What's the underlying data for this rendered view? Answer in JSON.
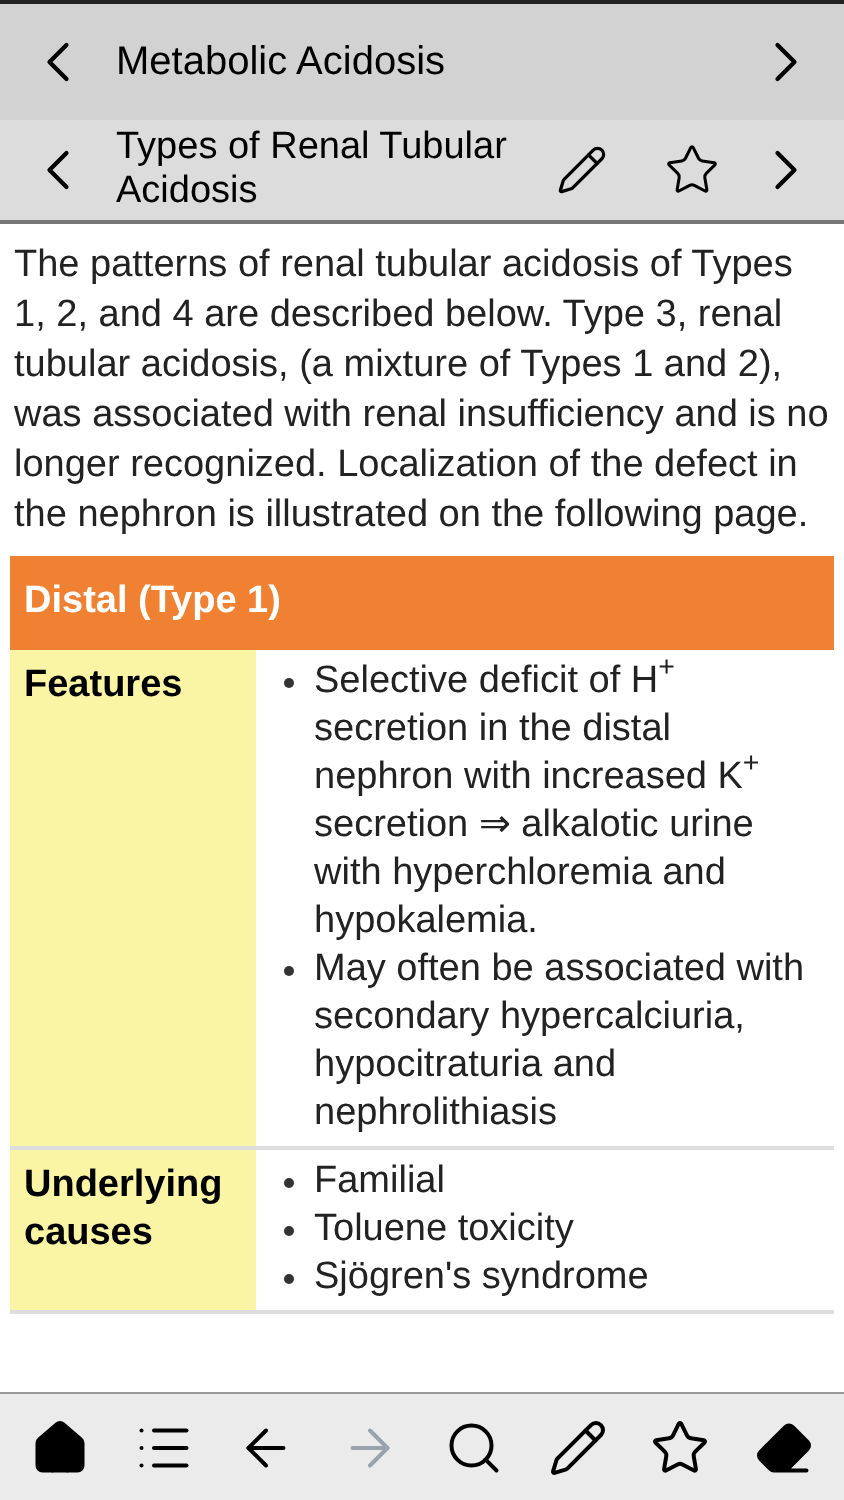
{
  "nav_bar": {
    "title": "Metabolic Acidosis"
  },
  "topic_bar": {
    "title": "Types of Renal Tubular Acidosis"
  },
  "intro": "The patterns of renal tubular acidosis of Types 1, 2, and 4 are described below. Type 3, renal tubular acidosis, (a mixture of Types 1 and 2), was associated with renal insufficiency and is no longer recognized. Localization of the defect in the nephron is illustrated on the following page.",
  "section": {
    "title": "Distal (Type 1)",
    "rows": [
      {
        "label": "Features",
        "items": [
          "Selective deficit of H$^{+}$ secretion in the distal nephron with increased K$^{+}$ secretion ⇒ alkalotic urine with hyperchloremia and hypokalemia.",
          "May often be associated with secondary hypercalciuria, hypocitraturia and nephrolithiasis"
        ]
      },
      {
        "label": "Underlying causes",
        "items": [
          "Familial",
          "Toluene toxicity",
          "Sjögren's syndrome"
        ]
      }
    ]
  },
  "toolbar": [
    {
      "kind": "home",
      "disabled": false
    },
    {
      "kind": "list",
      "disabled": false
    },
    {
      "kind": "back",
      "disabled": false
    },
    {
      "kind": "forward",
      "disabled": true
    },
    {
      "kind": "search",
      "disabled": false
    },
    {
      "kind": "pencil",
      "disabled": false
    },
    {
      "kind": "star",
      "disabled": false
    },
    {
      "kind": "eraser",
      "disabled": false
    }
  ]
}
